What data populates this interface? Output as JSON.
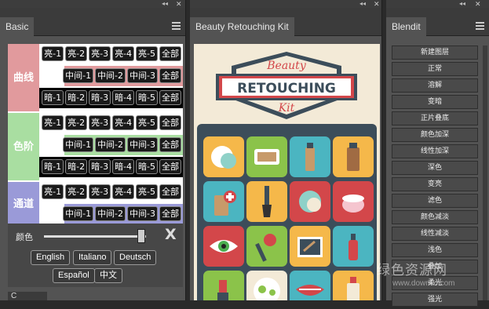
{
  "panels": {
    "basic": {
      "tab": "Basic",
      "bands": [
        {
          "label": "曲线",
          "color": "#e19a9d",
          "rows": [
            [
              "亮-1",
              "亮-2",
              "亮-3",
              "亮-4",
              "亮-5",
              "全部"
            ],
            [
              "中间-1",
              "中间-2",
              "中间-3",
              "全部"
            ],
            [
              "暗-1",
              "暗-2",
              "暗-3",
              "暗-4",
              "暗-5",
              "全部"
            ]
          ]
        },
        {
          "label": "色阶",
          "color": "#a9dea1",
          "rows": [
            [
              "亮-1",
              "亮-2",
              "亮-3",
              "亮-4",
              "亮-5",
              "全部"
            ],
            [
              "中间-1",
              "中间-2",
              "中间-3",
              "全部"
            ],
            [
              "暗-1",
              "暗-2",
              "暗-3",
              "暗-4",
              "暗-5",
              "全部"
            ]
          ]
        },
        {
          "label": "通道",
          "color": "#9a9ad8",
          "rows": [
            [
              "亮-1",
              "亮-2",
              "亮-3",
              "亮-4",
              "亮-5",
              "全部"
            ],
            [
              "中间-1",
              "中间-2",
              "中间-3",
              "全部"
            ]
          ]
        }
      ],
      "slider_label": "颜色",
      "slider_value": 0.95,
      "close_x": "X",
      "languages": [
        "English",
        "Italiano",
        "Deutsch",
        "Español",
        "中文"
      ],
      "bottom_tab": "C"
    },
    "beauty": {
      "tab": "Beauty Retouching Kit",
      "logo_top": "Beauty",
      "logo_mid": "RETOUCHING",
      "logo_bottom": "Kit",
      "colors": {
        "bg": "#f3ead7",
        "ribbon": "#d3474a",
        "banner": "#ffffff",
        "grid": "#3c4d5a"
      }
    },
    "blendit": {
      "tab": "Blendit",
      "items": [
        "新建图层",
        "正常",
        "溶解",
        "变暗",
        "正片叠底",
        "颜色加深",
        "线性加深",
        "深色",
        "变亮",
        "滤色",
        "颜色减淡",
        "线性减淡",
        "浅色",
        "叠加",
        "柔光",
        "强光"
      ]
    }
  },
  "watermark": {
    "text": "绿色资源网",
    "sub": "www.downcc.com"
  }
}
